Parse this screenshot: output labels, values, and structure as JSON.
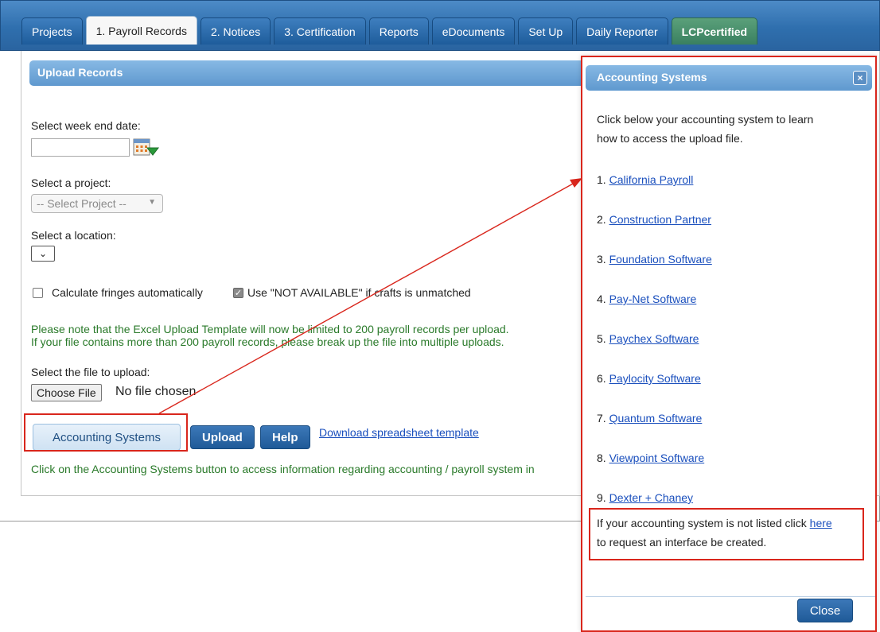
{
  "tabs": [
    {
      "label": "Projects"
    },
    {
      "label": "1. Payroll Records"
    },
    {
      "label": "2. Notices"
    },
    {
      "label": "3. Certification"
    },
    {
      "label": "Reports"
    },
    {
      "label": "eDocuments"
    },
    {
      "label": "Set Up"
    },
    {
      "label": "Daily Reporter"
    },
    {
      "label": "LCPcertified"
    }
  ],
  "panel": {
    "title": "Upload Records",
    "week_end_label": "Select week end date:",
    "project_label": "Select a project:",
    "project_select_value": "-- Select Project --",
    "location_label": "Select a location:",
    "fringes_label": "Calculate fringes automatically",
    "not_available_label": "Use \"NOT AVAILABLE\" if crafts is unmatched",
    "note_line1": "Please note that the Excel Upload Template will now be limited to 200 payroll records per upload.",
    "note_line2": "If your file contains more than 200 payroll records, please break up the file into multiple uploads.",
    "file_label": "Select the file to upload:",
    "choose_file_label": "Choose File",
    "file_status": "No file chosen",
    "accounting_button": "Accounting Systems",
    "upload_button": "Upload",
    "help_button": "Help",
    "download_link": "Download spreadsheet template",
    "footer_note": "Click on the Accounting Systems button to access information regarding accounting / payroll system in"
  },
  "dialog": {
    "title": "Accounting Systems",
    "close_x": "×",
    "intro_line1": "Click below your accounting system to learn",
    "intro_line2": "how to access the upload file.",
    "systems": [
      {
        "num": "1.",
        "name": "California Payroll"
      },
      {
        "num": "2.",
        "name": "Construction Partner"
      },
      {
        "num": "3.",
        "name": "Foundation Software"
      },
      {
        "num": "4.",
        "name": "Pay-Net Software"
      },
      {
        "num": "5.",
        "name": "Paychex Software"
      },
      {
        "num": "6.",
        "name": "Paylocity Software"
      },
      {
        "num": "7.",
        "name": "Quantum Software"
      },
      {
        "num": "8.",
        "name": "Viewpoint Software"
      },
      {
        "num": "9.",
        "name": "Dexter + Chaney"
      }
    ],
    "not_listed_prefix": "If your accounting system is not listed click",
    "not_listed_link": "here",
    "not_listed_suffix": "to request an interface be created.",
    "close_button": "Close"
  },
  "colors": {
    "annotation_red": "#d9261c",
    "note_green": "#2a7a2a",
    "link_blue": "#1a4fbd",
    "tab_blue": "#2f6fae"
  }
}
